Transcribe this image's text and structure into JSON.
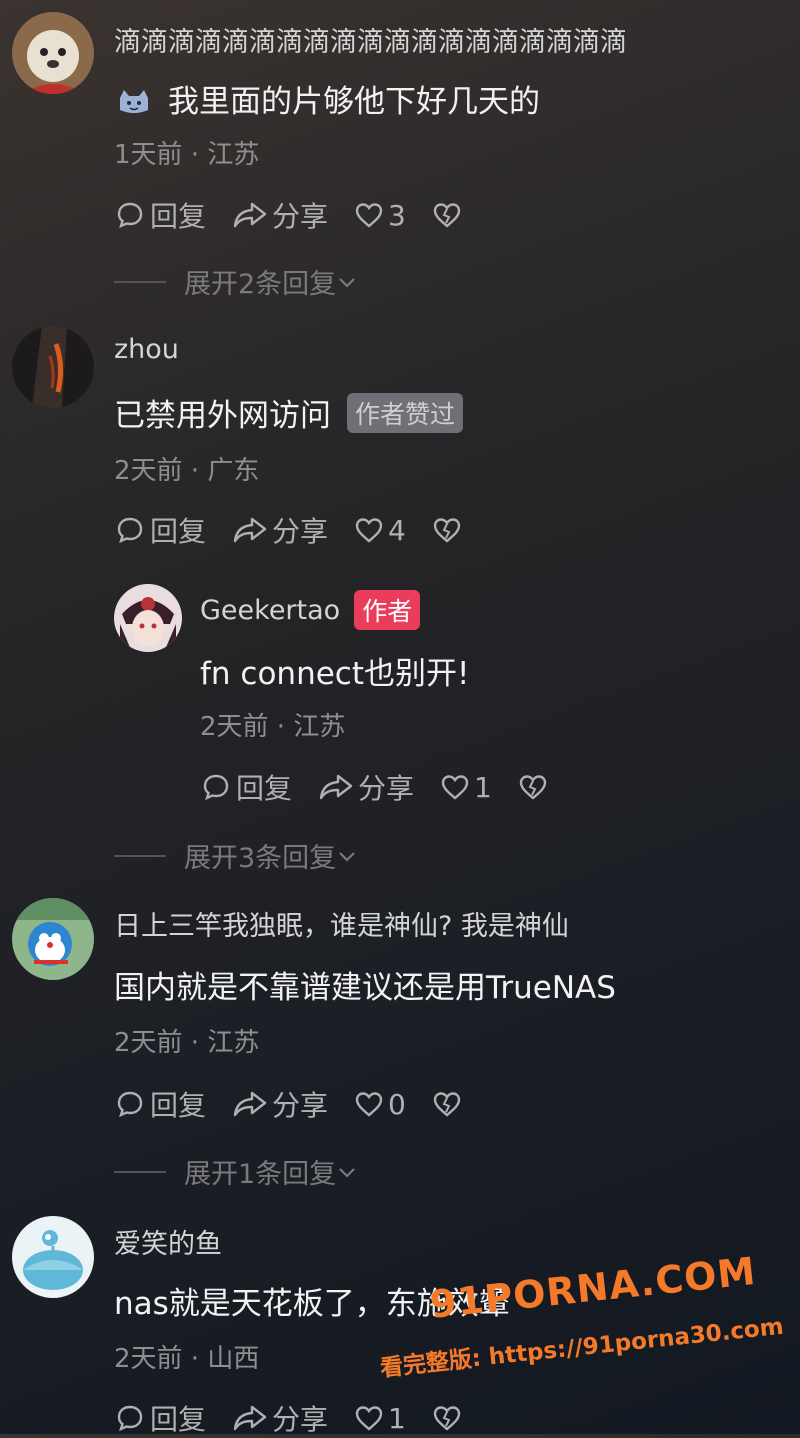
{
  "comments": [
    {
      "username": "滴滴滴滴滴滴滴滴滴滴滴滴滴滴滴滴滴滴滴",
      "content": "我里面的片够他下好几天的",
      "meta": "1天前 · 江苏",
      "reply_label": "回复",
      "share_label": "分享",
      "likes": "3",
      "expand": "展开2条回复"
    },
    {
      "username": "zhou",
      "content": "已禁用外网访问",
      "badge": "作者赞过",
      "meta": "2天前 · 广东",
      "reply_label": "回复",
      "share_label": "分享",
      "likes": "4",
      "reply": {
        "username": "Geekertao",
        "badge": "作者",
        "content": "fn connect也别开!",
        "meta": "2天前 · 江苏",
        "reply_label": "回复",
        "share_label": "分享",
        "likes": "1"
      },
      "expand": "展开3条回复"
    },
    {
      "username": "日上三竿我独眠，谁是神仙? 我是神仙",
      "content": "国内就是不靠谱建议还是用TrueNAS",
      "meta": "2天前 · 江苏",
      "reply_label": "回复",
      "share_label": "分享",
      "likes": "0",
      "expand": "展开1条回复"
    },
    {
      "username": "爱笑的鱼",
      "content": "nas就是天花板了，东施效颦",
      "meta": "2天前 · 山西",
      "reply_label": "回复",
      "share_label": "分享",
      "likes": "1"
    }
  ],
  "watermark": {
    "logo": "91PORNA.COM",
    "url": "看完整版: https://91porna30.com"
  }
}
